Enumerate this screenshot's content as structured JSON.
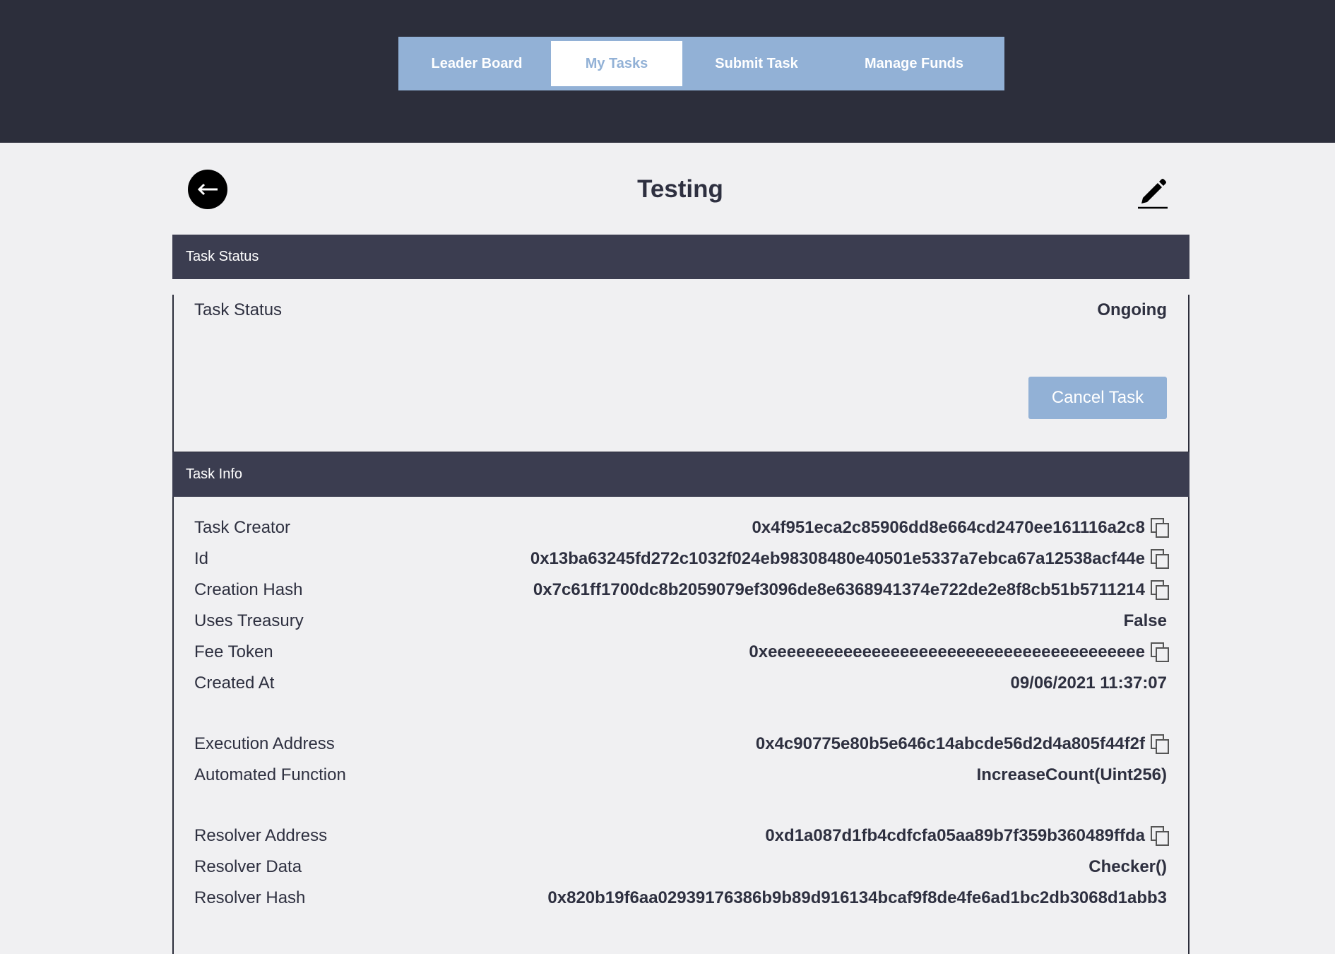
{
  "nav": {
    "tabs": [
      {
        "label": "Leader Board"
      },
      {
        "label": "My Tasks"
      },
      {
        "label": "Submit Task"
      },
      {
        "label": "Manage Funds"
      }
    ],
    "active_tab": "My Tasks"
  },
  "header": {
    "title": "Testing",
    "back_icon": "arrow-left-icon",
    "edit_icon": "pencil-icon"
  },
  "status_panel": {
    "header": "Task Status",
    "label": "Task Status",
    "value": "Ongoing",
    "cancel_label": "Cancel Task"
  },
  "info_panel": {
    "header": "Task Info",
    "rows": [
      {
        "label": "Task Creator",
        "value": "0x4f951eca2c85906dd8e664cd2470ee161116a2c8",
        "copyable": true
      },
      {
        "label": "Id",
        "value": "0x13ba63245fd272c1032f024eb98308480e40501e5337a7ebca67a12538acf44e",
        "copyable": true
      },
      {
        "label": "Creation Hash",
        "value": "0x7c61ff1700dc8b2059079ef3096de8e6368941374e722de2e8f8cb51b5711214",
        "copyable": true
      },
      {
        "label": "Uses Treasury",
        "value": "False",
        "copyable": false
      },
      {
        "label": "Fee Token",
        "value": "0xeeeeeeeeeeeeeeeeeeeeeeeeeeeeeeeeeeeeeeee",
        "copyable": true
      },
      {
        "label": "Created At",
        "value": "09/06/2021 11:37:07",
        "copyable": false
      },
      {
        "label": "Execution Address",
        "value": "0x4c90775e80b5e646c14abcde56d2d4a805f44f2f",
        "copyable": true
      },
      {
        "label": "Automated Function",
        "value": "IncreaseCount(Uint256)",
        "copyable": false
      },
      {
        "label": "Resolver Address",
        "value": "0xd1a087d1fb4cdfcfa05aa89b7f359b360489ffda",
        "copyable": true
      },
      {
        "label": "Resolver Data",
        "value": "Checker()",
        "copyable": false
      },
      {
        "label": "Resolver Hash",
        "value": "0x820b19f6aa02939176386b9b89d916134bcaf9f8de4fe6ad1bc2db3068d1abb3",
        "copyable": false
      }
    ]
  },
  "colors": {
    "topbar": "#2c2e3b",
    "accent": "#92b1d6",
    "panel_header": "#3b3d50",
    "background": "#f0f0f2"
  }
}
